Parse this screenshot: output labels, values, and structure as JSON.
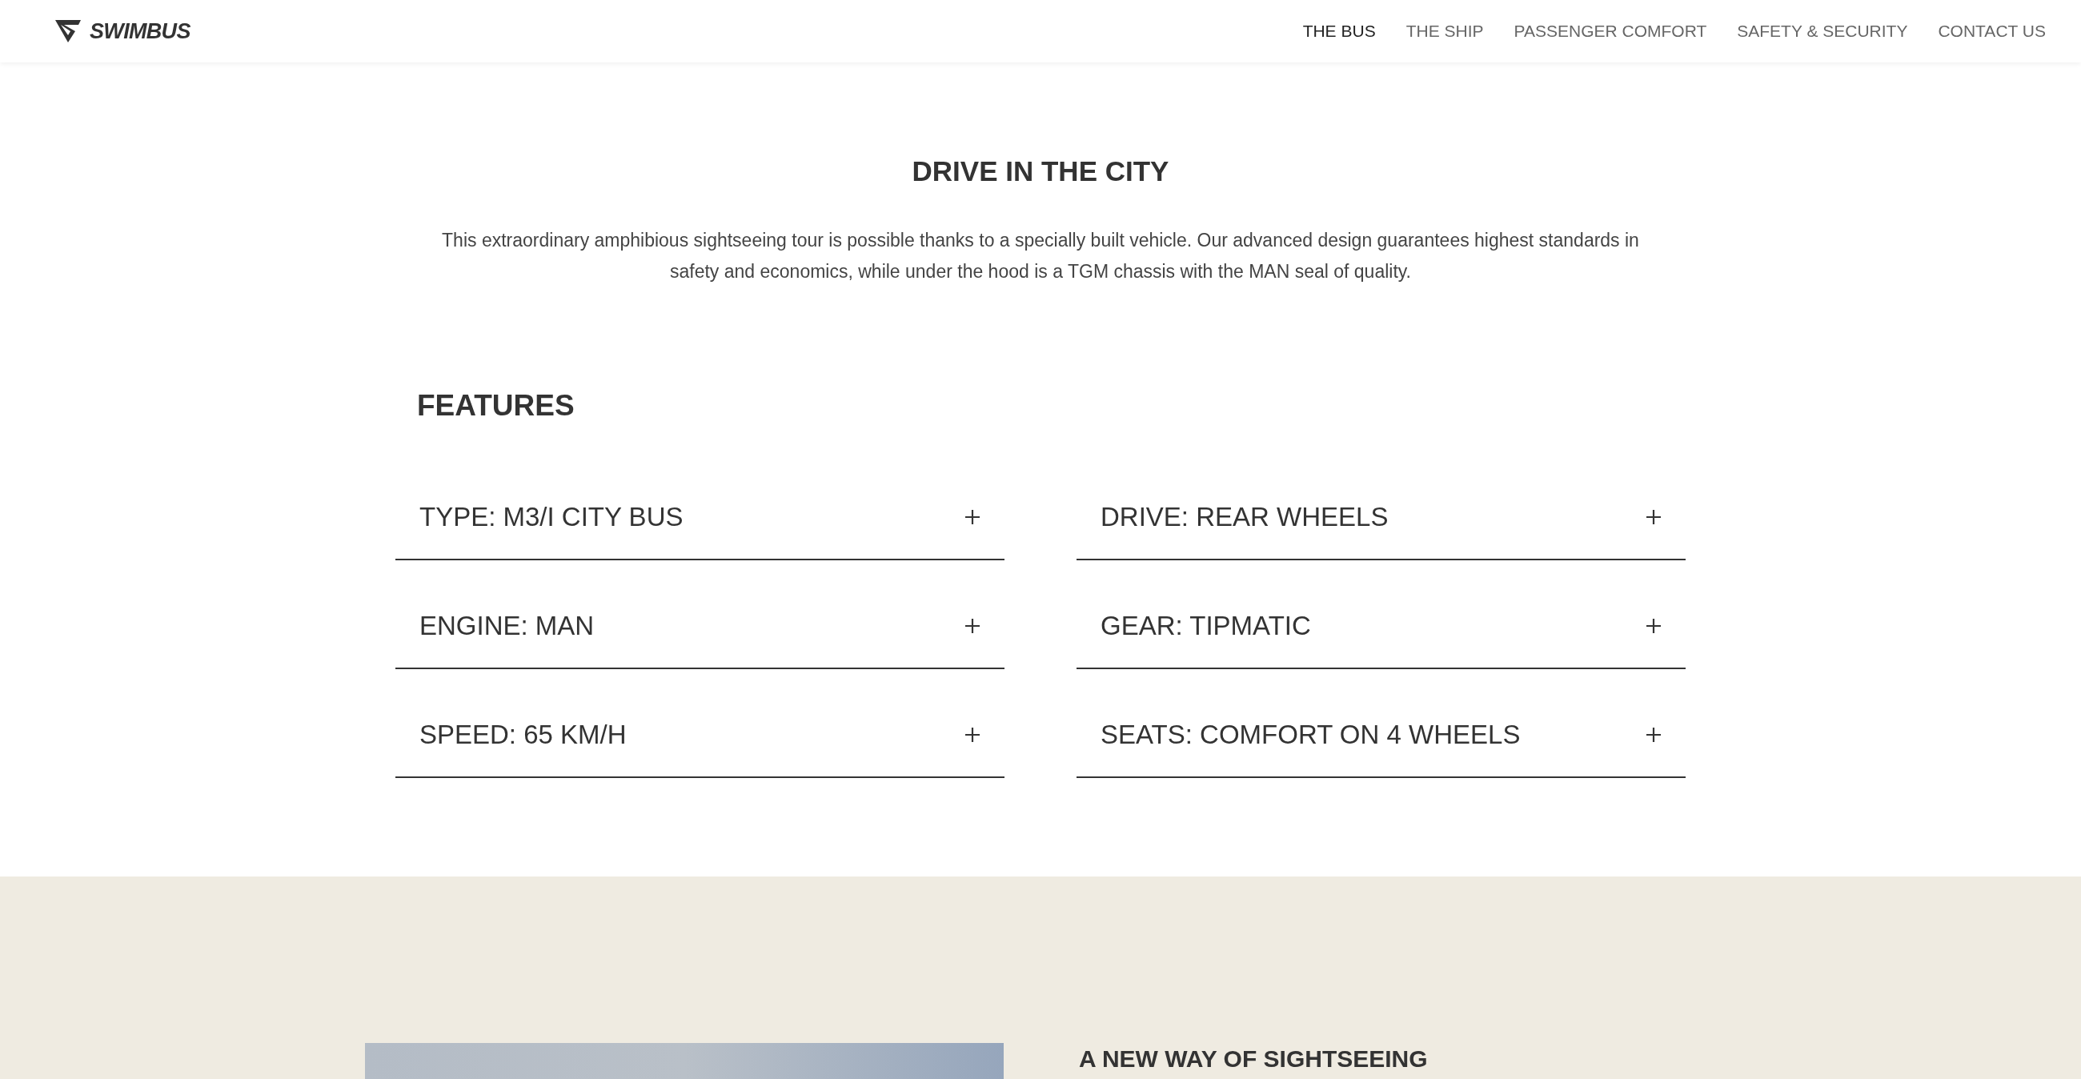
{
  "header": {
    "logo": "SWIMBUS",
    "nav": [
      {
        "label": "THE BUS",
        "selected": true
      },
      {
        "label": "THE SHIP",
        "selected": false
      },
      {
        "label": "PASSENGER COMFORT",
        "selected": false
      },
      {
        "label": "SAFETY & SECURITY",
        "selected": false
      },
      {
        "label": "CONTACT US",
        "selected": false
      }
    ]
  },
  "intro": {
    "title": "DRIVE IN THE CITY",
    "text": "This extraordinary amphibious sightseeing tour is possible thanks to a specially built vehicle. Our advanced design guarantees highest standards in safety and economics, while under the hood is a TGM chassis with the MAN seal of quality."
  },
  "features": {
    "title": "FEATURES",
    "items": [
      {
        "label": "TYPE: M3/I CITY BUS",
        "expanded": false
      },
      {
        "label": "DRIVE: REAR WHEELS",
        "expanded": false
      },
      {
        "label": "ENGINE: MAN",
        "expanded": false
      },
      {
        "label": "GEAR: TIPMATIC",
        "expanded": false
      },
      {
        "label": "SPEED: 65 KM/H",
        "expanded": false
      },
      {
        "label": "SEATS: COMFORT ON 4 WHEELS",
        "expanded": false
      }
    ]
  },
  "sightseeing": {
    "title": "A NEW WAY OF SIGHTSEEING"
  }
}
